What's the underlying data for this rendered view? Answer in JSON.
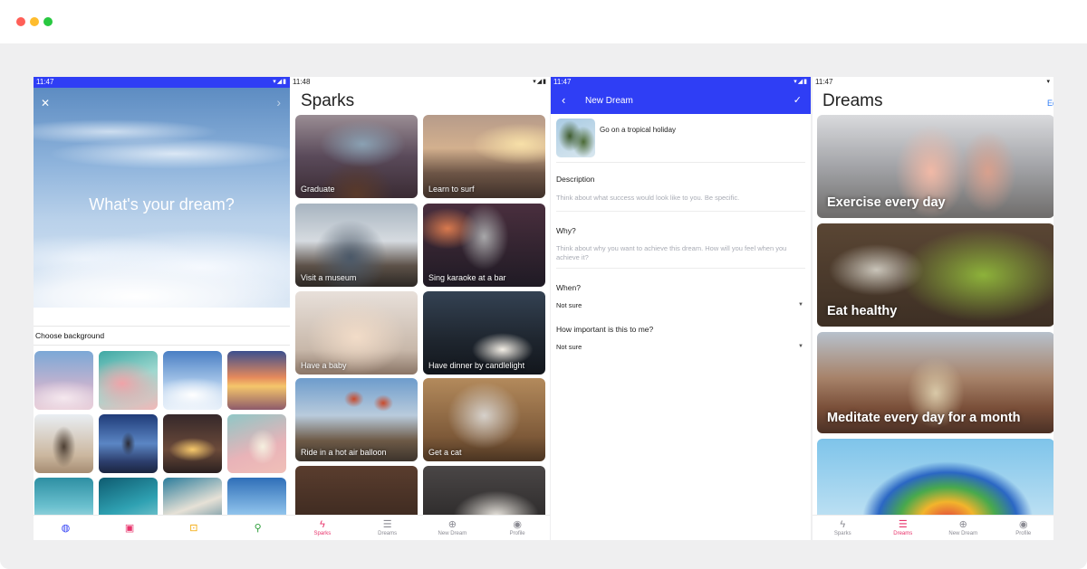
{
  "window": {
    "dot_colors": [
      "#ff5f57",
      "#febc2e",
      "#28c840"
    ]
  },
  "colors": {
    "accent_blue": "#2f3ef5",
    "active_pink": "#e8336b",
    "link_blue": "#2f7cf5"
  },
  "screen1": {
    "status": {
      "time": "11:47",
      "icons": "▾◢▮"
    },
    "close_icon": "✕",
    "next_icon": "›",
    "prompt": "What's your dream?",
    "choose_background_label": "Choose background",
    "nav": [
      {
        "icon": "palette-icon",
        "glyph": "◍",
        "color": "#2f3ef5"
      },
      {
        "icon": "image-icon",
        "glyph": "▣",
        "color": "#e8336b"
      },
      {
        "icon": "briefcase-icon",
        "glyph": "⊡",
        "color": "#f2a600"
      },
      {
        "icon": "search-icon",
        "glyph": "⚲",
        "color": "#2e9e3a"
      }
    ]
  },
  "screen2": {
    "status": {
      "time": "11:48",
      "icons": "▾◢▮"
    },
    "title": "Sparks",
    "cards": [
      {
        "label": "Graduate"
      },
      {
        "label": "Learn to surf"
      },
      {
        "label": "Visit a museum"
      },
      {
        "label": "Sing karaoke at a bar"
      },
      {
        "label": "Have a baby"
      },
      {
        "label": "Have dinner by candlelight"
      },
      {
        "label": "Ride in a hot air balloon"
      },
      {
        "label": "Get a cat"
      },
      {
        "label": ""
      },
      {
        "label": ""
      }
    ],
    "nav": [
      {
        "label": "Sparks",
        "icon": "lightning-icon",
        "glyph": "ϟ",
        "active": true
      },
      {
        "label": "Dreams",
        "icon": "list-icon",
        "glyph": "☰",
        "active": false
      },
      {
        "label": "New Dream",
        "icon": "add-circle-icon",
        "glyph": "⊕",
        "active": false
      },
      {
        "label": "Profile",
        "icon": "profile-icon",
        "glyph": "◉",
        "active": false
      }
    ]
  },
  "screen3": {
    "status": {
      "time": "11:47",
      "icons": "▾◢▮"
    },
    "appbar": {
      "back_icon": "‹",
      "title": "New Dream",
      "check_icon": "✓"
    },
    "dream_name": "Go on a tropical holiday",
    "description": {
      "label": "Description",
      "hint": "Think about what success would look like to you. Be specific."
    },
    "why": {
      "label": "Why?",
      "hint": "Think about why you want to achieve this dream. How will you feel when you achieve it?"
    },
    "when": {
      "label": "When?",
      "value": "Not sure"
    },
    "importance": {
      "label": "How important is this to me?",
      "value": "Not sure"
    },
    "caret_icon": "▼"
  },
  "screen4": {
    "status": {
      "icons": "▾"
    },
    "time": "11:47",
    "title": "Dreams",
    "edit_label": "Ed",
    "cards": [
      {
        "label": "Exercise every day"
      },
      {
        "label": "Eat healthy"
      },
      {
        "label": "Meditate every day for a month"
      },
      {
        "label": ""
      }
    ],
    "nav": [
      {
        "label": "Sparks",
        "icon": "lightning-icon",
        "glyph": "ϟ",
        "active": false
      },
      {
        "label": "Dreams",
        "icon": "list-icon",
        "glyph": "☰",
        "active": true
      },
      {
        "label": "New Dream",
        "icon": "add-circle-icon",
        "glyph": "⊕",
        "active": false
      },
      {
        "label": "Profile",
        "icon": "profile-icon",
        "glyph": "◉",
        "active": false
      }
    ]
  }
}
